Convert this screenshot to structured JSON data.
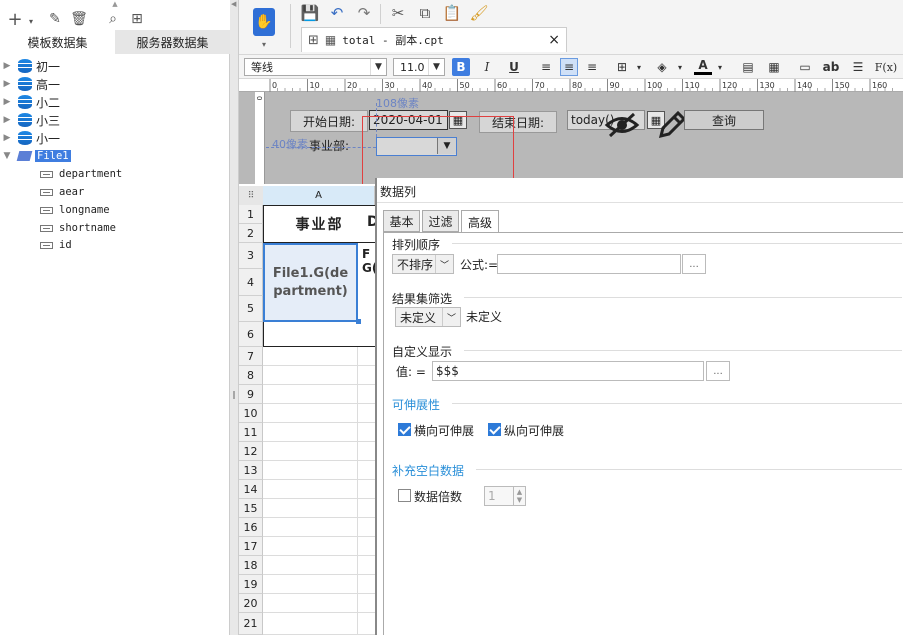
{
  "left_panel": {
    "tabs": [
      {
        "label": "模板数据集",
        "active": true
      },
      {
        "label": "服务器数据集",
        "active": false
      }
    ],
    "toolbar_icons": [
      "add-icon",
      "edit-icon",
      "delete-icon",
      "preview-icon",
      "data-connection-icon"
    ],
    "datasets": [
      {
        "name": "初一"
      },
      {
        "name": "高一"
      },
      {
        "name": "小二"
      },
      {
        "name": "小三"
      },
      {
        "name": "小一"
      }
    ],
    "file_dataset": {
      "name": "File1",
      "fields": [
        "department",
        "aear",
        "longname",
        "shortname",
        "id"
      ]
    }
  },
  "toolbar": {
    "file_tab": "total - 副本.cpt",
    "close_glyph": "×"
  },
  "format_bar": {
    "font_name": "等线",
    "font_size": "11.0",
    "bold": "B",
    "italic": "I",
    "underline": "U",
    "text_tool": "ab",
    "formula_tool": "F(x)"
  },
  "ruler": {
    "ticks": [
      "0",
      "10",
      "20",
      "30",
      "40",
      "50",
      "60",
      "70",
      "80",
      "90",
      "100",
      "110",
      "120",
      "130",
      "140",
      "150",
      "160"
    ]
  },
  "parameter_pane": {
    "start_date_label": "开始日期:",
    "start_date_value": "2020-04-01",
    "end_date_label": "结束日期:",
    "end_date_value": "today()",
    "department_label": "事业部:",
    "query_button": "查询",
    "width_hint": "108像素",
    "height_hint": "40像素"
  },
  "sheet": {
    "column_header": "A",
    "header_cell": "事业部",
    "header_cell_partial": "D",
    "data_cell": "File1.G(department)",
    "data_cell_partial": "F\nG(",
    "row_numbers": [
      "1",
      "2",
      "3",
      "4",
      "5",
      "6",
      "7",
      "8",
      "9",
      "10",
      "11",
      "12",
      "13",
      "14",
      "15",
      "16",
      "17",
      "18",
      "19",
      "20",
      "21"
    ]
  },
  "dialog": {
    "title": "数据列",
    "tabs": [
      {
        "label": "基本",
        "active": false
      },
      {
        "label": "过滤",
        "active": false
      },
      {
        "label": "高级",
        "active": true
      }
    ],
    "sort": {
      "section_label": "排列顺序",
      "select_value": "不排序",
      "formula_label": "公式:=",
      "formula_value": "",
      "ellipsis": "..."
    },
    "filter": {
      "section_label": "结果集筛选",
      "select_value": "未定义",
      "result_label": "未定义"
    },
    "custom_display": {
      "section_label": "自定义显示",
      "value_label": "值:  =",
      "value": "$$$",
      "ellipsis": "..."
    },
    "expandability": {
      "section_label": "可伸展性",
      "horizontal_label": "横向可伸展",
      "horizontal_checked": true,
      "vertical_label": "纵向可伸展",
      "vertical_checked": true
    },
    "fill_blank": {
      "section_label": "补充空白数据",
      "multiple_label": "数据倍数",
      "multiple_checked": false,
      "multiple_value": "1"
    }
  },
  "colors": {
    "accent": "#2a8fd8",
    "selection_border": "#3a7fd5",
    "highlight_red": "#e04040"
  }
}
